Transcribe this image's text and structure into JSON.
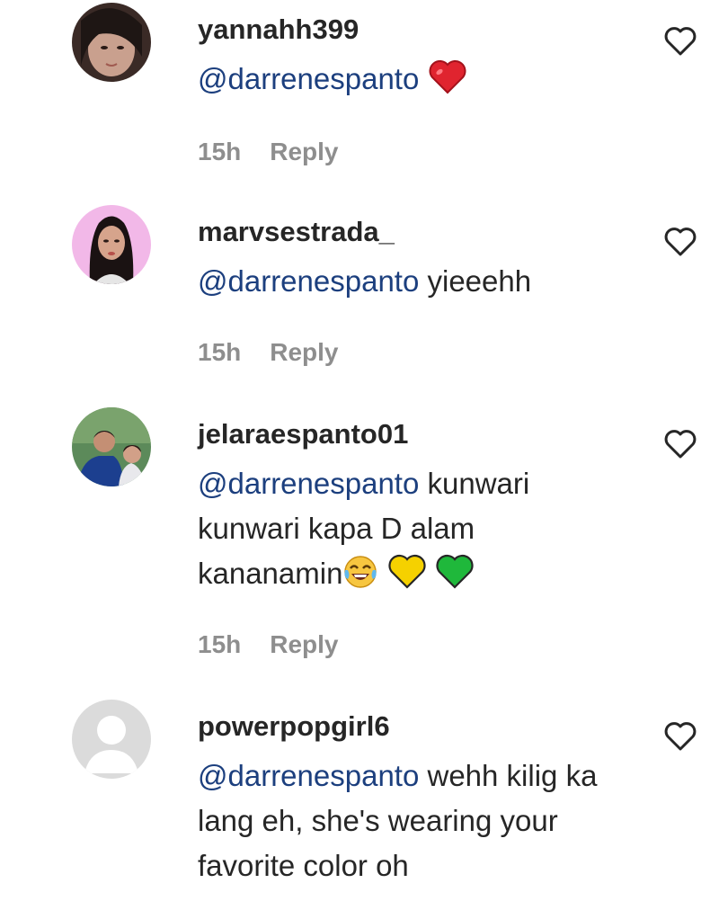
{
  "comments": [
    {
      "username": "yannahh399",
      "mention": "@darrenespanto",
      "body": "",
      "emojis": [
        "red-heart"
      ],
      "time": "15h",
      "reply_label": "Reply"
    },
    {
      "username": "marvsestrada_",
      "mention": "@darrenespanto",
      "body": " yieeehh",
      "emojis": [],
      "time": "15h",
      "reply_label": "Reply"
    },
    {
      "username": "jelaraespanto01",
      "mention": "@darrenespanto",
      "body": " kunwari kunwari kapa D alam kananamin",
      "emojis": [
        "tears-of-joy",
        "yellow-heart",
        "green-heart"
      ],
      "time": "15h",
      "reply_label": "Reply"
    },
    {
      "username": "powerpopgirl6",
      "mention": "@darrenespanto",
      "body": " wehh kilig ka lang eh, she's wearing your favorite color oh",
      "emojis": [],
      "time": "",
      "reply_label": ""
    }
  ],
  "colors": {
    "text": "#262626",
    "mention": "#1c3f7e",
    "meta": "#8e8e8e",
    "red_heart": "#e0242f",
    "yellow_heart": "#f5d100",
    "green_heart": "#1fb83b"
  },
  "icons": {
    "like": "heart-outline-icon"
  }
}
